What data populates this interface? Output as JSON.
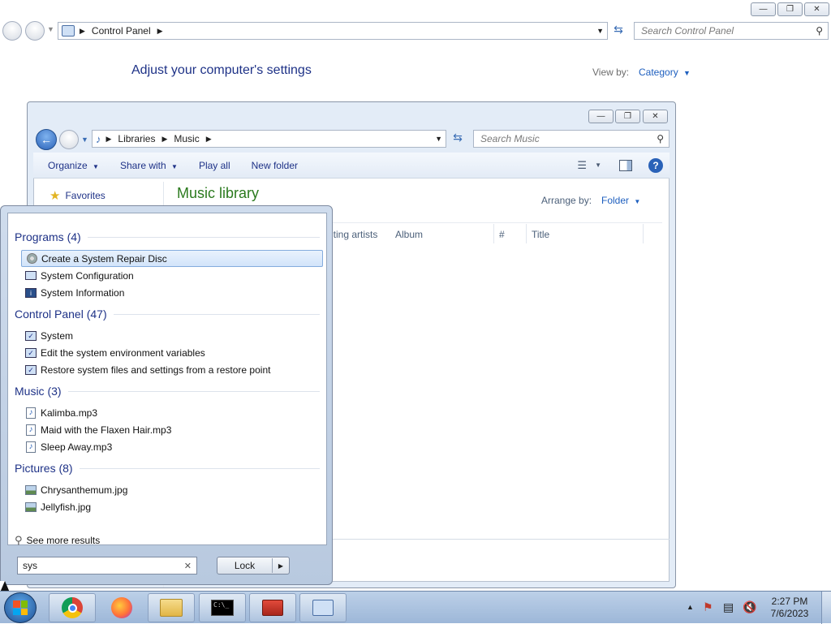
{
  "control_panel": {
    "breadcrumb": "Control Panel",
    "search_placeholder": "Search Control Panel",
    "heading": "Adjust your computer's settings",
    "view_by_label": "View by:",
    "view_by_value": "Category"
  },
  "music_window": {
    "breadcrumb": [
      "Libraries",
      "Music"
    ],
    "search_placeholder": "Search Music",
    "toolbar": {
      "organize": "Organize",
      "share_with": "Share with",
      "play_all": "Play all",
      "new_folder": "New folder"
    },
    "nav": {
      "favorites": "Favorites"
    },
    "library_title": "Music library",
    "arrange_label": "Arrange by:",
    "arrange_value": "Folder",
    "columns": [
      "uting artists",
      "Album",
      "#",
      "Title"
    ]
  },
  "start_menu": {
    "groups": [
      {
        "header": "Programs (4)",
        "items": [
          "Create a System Repair Disc",
          "System Configuration",
          "System Information"
        ]
      },
      {
        "header": "Control Panel (47)",
        "items": [
          "System",
          "Edit the system environment variables",
          "Restore system files and settings from a restore point"
        ]
      },
      {
        "header": "Music (3)",
        "items": [
          "Kalimba.mp3",
          "Maid with the Flaxen Hair.mp3",
          "Sleep Away.mp3"
        ]
      },
      {
        "header": "Pictures (8)",
        "items": [
          "Chrysanthemum.jpg",
          "Jellyfish.jpg"
        ]
      }
    ],
    "see_more": "See more results",
    "search_value": "sys",
    "lock_label": "Lock"
  },
  "taskbar": {
    "time": "2:27 PM",
    "date": "7/6/2023",
    "apps": [
      "chrome-icon",
      "firefox-icon",
      "file-explorer-icon",
      "command-prompt-icon",
      "toolbox-icon",
      "control-panel-icon"
    ]
  },
  "colors": {
    "accent": "#1e3287",
    "link": "#1e5fbf",
    "library_title": "#2b7a1e",
    "selection": "#d2e4fa"
  }
}
